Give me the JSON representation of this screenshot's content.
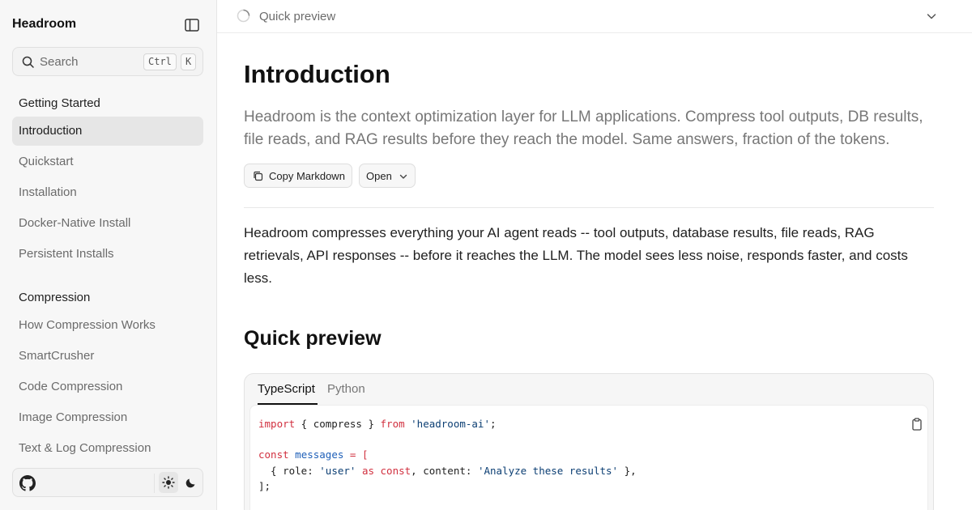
{
  "sidebar": {
    "brand": "Headroom",
    "search": {
      "placeholder": "Search",
      "shortcut_ctrl": "Ctrl",
      "shortcut_key": "K"
    },
    "sections": [
      {
        "title": "Getting Started",
        "items": [
          "Introduction",
          "Quickstart",
          "Installation",
          "Docker-Native Install",
          "Persistent Installs"
        ]
      },
      {
        "title": "Compression",
        "items": [
          "How Compression Works",
          "SmartCrusher",
          "Code Compression",
          "Image Compression",
          "Text & Log Compression"
        ]
      }
    ],
    "active_item": "Introduction"
  },
  "topbar": {
    "label": "Quick preview"
  },
  "main": {
    "title": "Introduction",
    "lead": "Headroom is the context optimization layer for LLM applications. Compress tool outputs, DB results, file reads, and RAG results before they reach the model. Same answers, fraction of the tokens.",
    "copy_markdown": "Copy Markdown",
    "open": "Open",
    "body": "Headroom compresses everything your AI agent reads -- tool outputs, database results, file reads, RAG retrievals, API responses -- before it reaches the LLM. The model sees less noise, responds faster, and costs less.",
    "quick_preview": "Quick preview"
  },
  "code": {
    "tabs": [
      "TypeScript",
      "Python"
    ],
    "active_tab": "TypeScript",
    "line1": {
      "kw1": "import",
      "mid": " { compress } ",
      "kw2": "from",
      "str": " 'headroom-ai'",
      "end": ";"
    },
    "line3": {
      "kw": "const",
      "var": " messages",
      "op": " = ["
    },
    "line4": {
      "pre": "  { role: ",
      "str1": "'user'",
      "kw1": " as const",
      "mid": ", content: ",
      "str2": "'Analyze these results'",
      "end": " },"
    },
    "line5": "];"
  },
  "colors": {
    "accent_keyword": "#d1303f",
    "string": "#0b3e73",
    "active_bg": "#e6e6e6"
  }
}
